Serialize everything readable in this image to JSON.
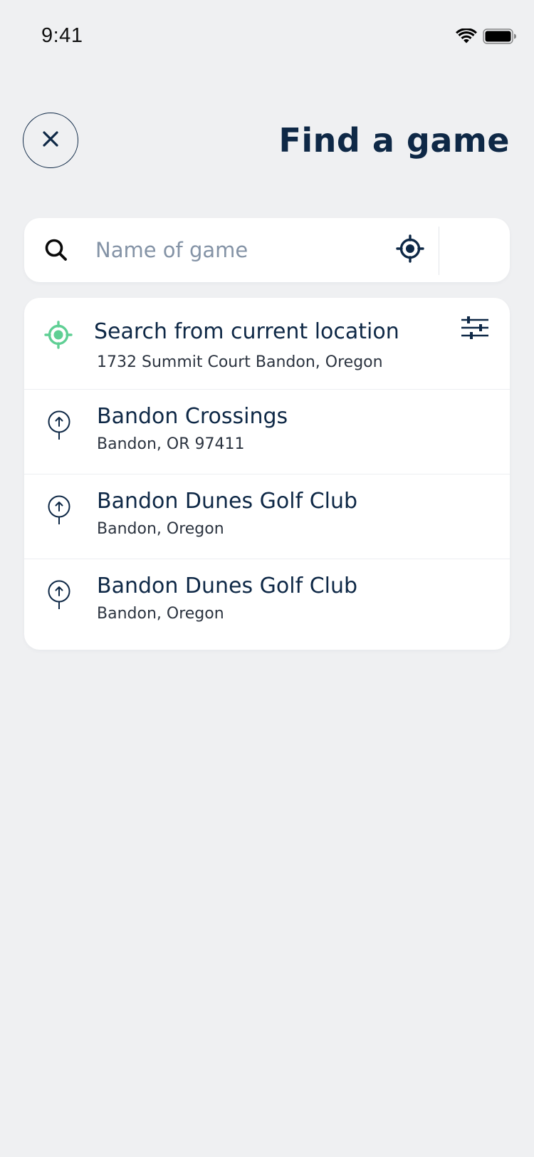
{
  "status_bar": {
    "time": "9:41",
    "icons": [
      "wifi-icon",
      "battery-icon"
    ]
  },
  "header": {
    "close_icon": "close-icon",
    "title": "Find a game"
  },
  "search": {
    "placeholder": "Name of game",
    "value": "",
    "search_icon": "search-icon",
    "locate_icon": "crosshair-icon"
  },
  "current_location": {
    "title": "Search from current location",
    "address": "1732 Summit Court Bandon, Oregon",
    "icon": "location-target-icon",
    "filter_icon": "sliders-icon"
  },
  "results": [
    {
      "title": "Bandon Crossings",
      "subtitle": "Bandon, OR 97411",
      "icon": "map-pin-icon"
    },
    {
      "title": "Bandon Dunes Golf Club",
      "subtitle": "Bandon, Oregon",
      "icon": "map-pin-icon"
    },
    {
      "title": "Bandon Dunes Golf Club",
      "subtitle": "Bandon, Oregon",
      "icon": "map-pin-icon"
    }
  ],
  "colors": {
    "background": "#eff0f2",
    "primary": "#0e2846",
    "accent": "#5fcf94",
    "placeholder": "#8493a6",
    "card": "#ffffff"
  }
}
